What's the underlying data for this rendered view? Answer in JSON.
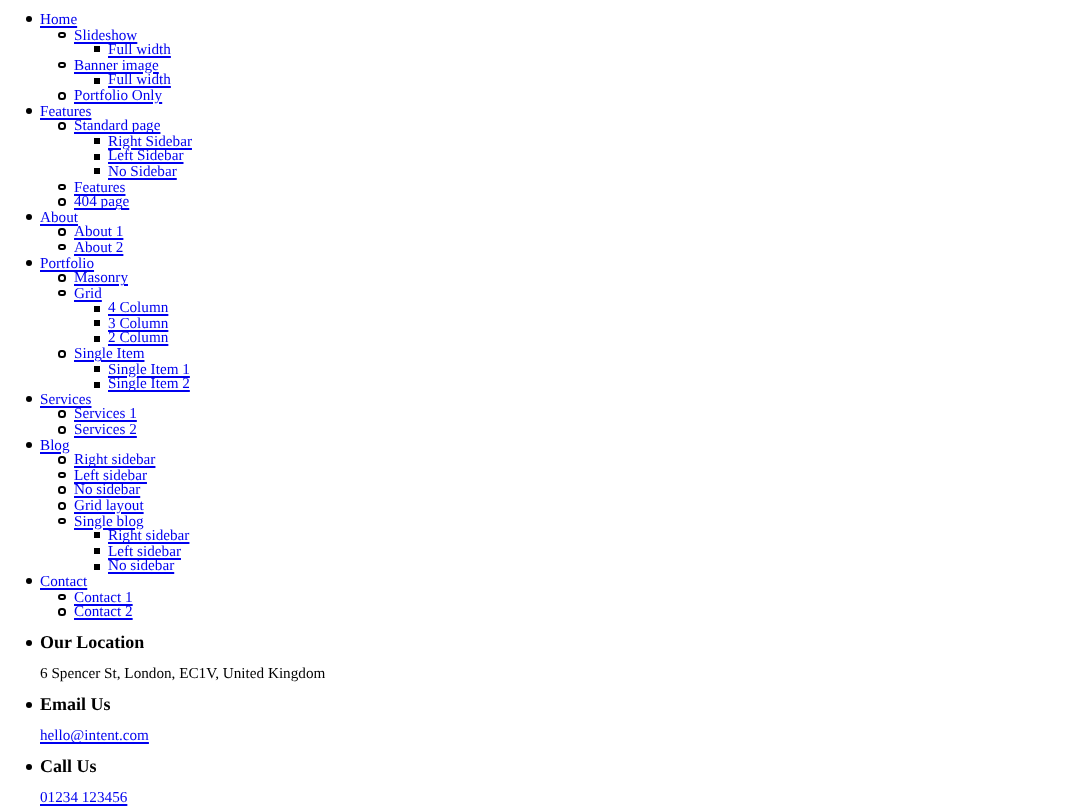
{
  "menu": [
    {
      "label": "Home",
      "children": [
        {
          "label": "Slideshow",
          "children": [
            {
              "label": "Full width"
            }
          ]
        },
        {
          "label": "Banner image",
          "children": [
            {
              "label": "Full width"
            }
          ]
        },
        {
          "label": "Portfolio Only"
        }
      ]
    },
    {
      "label": "Features",
      "children": [
        {
          "label": "Standard page",
          "children": [
            {
              "label": "Right Sidebar"
            },
            {
              "label": "Left Sidebar"
            },
            {
              "label": "No Sidebar"
            }
          ]
        },
        {
          "label": "Features"
        },
        {
          "label": "404 page"
        }
      ]
    },
    {
      "label": "About",
      "children": [
        {
          "label": "About 1"
        },
        {
          "label": "About 2"
        }
      ]
    },
    {
      "label": "Portfolio",
      "children": [
        {
          "label": "Masonry"
        },
        {
          "label": "Grid",
          "children": [
            {
              "label": "4 Column"
            },
            {
              "label": "3 Column"
            },
            {
              "label": "2 Column"
            }
          ]
        },
        {
          "label": "Single Item",
          "children": [
            {
              "label": "Single Item 1"
            },
            {
              "label": "Single Item 2"
            }
          ]
        }
      ]
    },
    {
      "label": "Services",
      "children": [
        {
          "label": "Services 1"
        },
        {
          "label": "Services 2"
        }
      ]
    },
    {
      "label": "Blog",
      "children": [
        {
          "label": "Right sidebar"
        },
        {
          "label": "Left sidebar"
        },
        {
          "label": "No sidebar"
        },
        {
          "label": "Grid layout"
        },
        {
          "label": "Single blog",
          "children": [
            {
              "label": "Right sidebar"
            },
            {
              "label": "Left sidebar"
            },
            {
              "label": "No sidebar"
            }
          ]
        }
      ]
    },
    {
      "label": "Contact",
      "children": [
        {
          "label": "Contact 1"
        },
        {
          "label": "Contact 2"
        }
      ]
    }
  ],
  "contact": [
    {
      "heading": "Our Location",
      "kind": "text",
      "text": "6 Spencer St, London, EC1V, United Kingdom"
    },
    {
      "heading": "Email Us",
      "kind": "email",
      "text": "hello@intent.com"
    },
    {
      "heading": "Call Us",
      "kind": "phone",
      "text": "01234 123456"
    }
  ]
}
